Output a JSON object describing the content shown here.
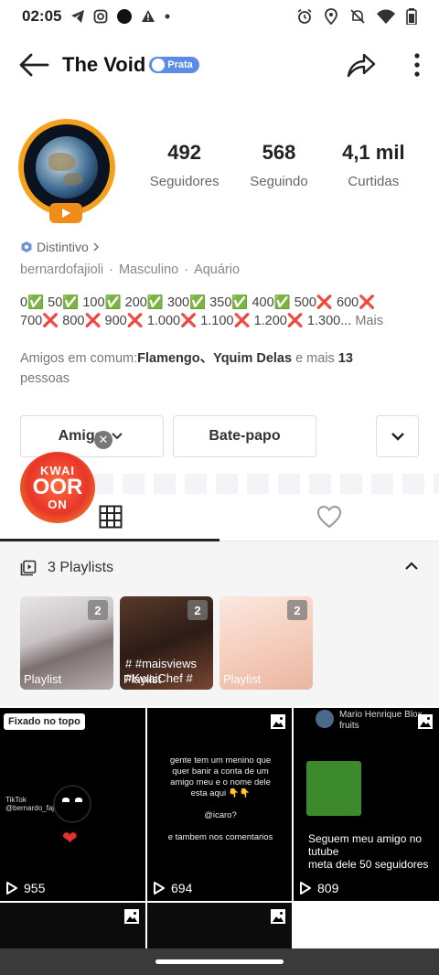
{
  "status_bar": {
    "time": "02:05"
  },
  "header": {
    "title": "The Void",
    "badge": "Prata"
  },
  "profile": {
    "stats": [
      {
        "value": "492",
        "label": "Seguidores"
      },
      {
        "value": "568",
        "label": "Seguindo"
      },
      {
        "value": "4,1 mil",
        "label": "Curtidas"
      }
    ],
    "distintivo": "Distintivo",
    "username": "bernardofajioli",
    "gender": "Masculino",
    "sign": "Aquário",
    "bio_line1": "0✅ 50✅ 100✅ 200✅ 300✅ 350✅ 400✅ 500❌ 600❌",
    "bio_line2": "700❌ 800❌ 900❌ 1.000❌ 1.100❌ 1.200❌ 1.300...",
    "bio_more": "Mais",
    "friends_prefix": "Amigos em comum:",
    "friends_names": "Flamengo、Yquim Delas",
    "friends_mid": " e mais ",
    "friends_count": "13",
    "friends_suffix": "pessoas"
  },
  "buttons": {
    "amigo": "Amigo",
    "chat": "Bate-papo"
  },
  "kwai": {
    "top": "KWAI",
    "main": "OOR",
    "sub": "ON"
  },
  "playlists": {
    "header": "3 Playlists",
    "items": [
      {
        "count": "2",
        "caption": "Playlist"
      },
      {
        "count": "2",
        "caption": "Playlist",
        "overlay": "# #maisviews\n#KwaiChef #"
      },
      {
        "count": "2",
        "caption": "Playlist"
      }
    ]
  },
  "videos": [
    {
      "views": "955",
      "pinned": "Fixado no topo",
      "watermark": "TikTok\n@bernardo_fajioli_01"
    },
    {
      "views": "694",
      "text": "gente tem um menino que quer banir a conta de um amigo meu e o nome dele esta aqui 👇👇\n\n@icaro?\n\ne tambem nos comentarios"
    },
    {
      "views": "809",
      "header": "Mario Henrique Blox fruits",
      "caption": "Seguem meu amigo no tutube\nmeta dele 50 seguidores"
    }
  ]
}
